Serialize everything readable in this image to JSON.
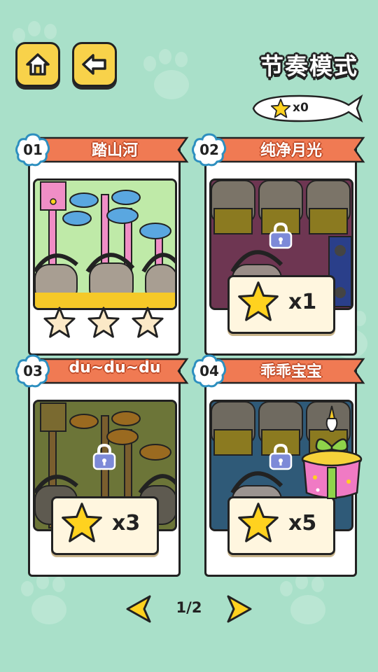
{
  "header": {
    "title": "节奏模式",
    "star_count": "x0"
  },
  "levels": [
    {
      "number": "01",
      "title": "踏山河",
      "locked": false,
      "stars_earned": 0,
      "stars_total": 3
    },
    {
      "number": "02",
      "title": "纯净月光",
      "locked": true,
      "unlock_cost": "x1"
    },
    {
      "number": "03",
      "title": "du~du~du",
      "locked": true,
      "unlock_cost": "x3"
    },
    {
      "number": "04",
      "title": "乖乖宝宝",
      "locked": true,
      "unlock_cost": "x5",
      "has_gift": true
    }
  ],
  "pagination": {
    "current": "1/2"
  },
  "colors": {
    "background": "#a9e0c9",
    "banner": "#f07a53",
    "button": "#f8d24a",
    "star": "#ffd21f",
    "lock": "#7d8ad8"
  }
}
